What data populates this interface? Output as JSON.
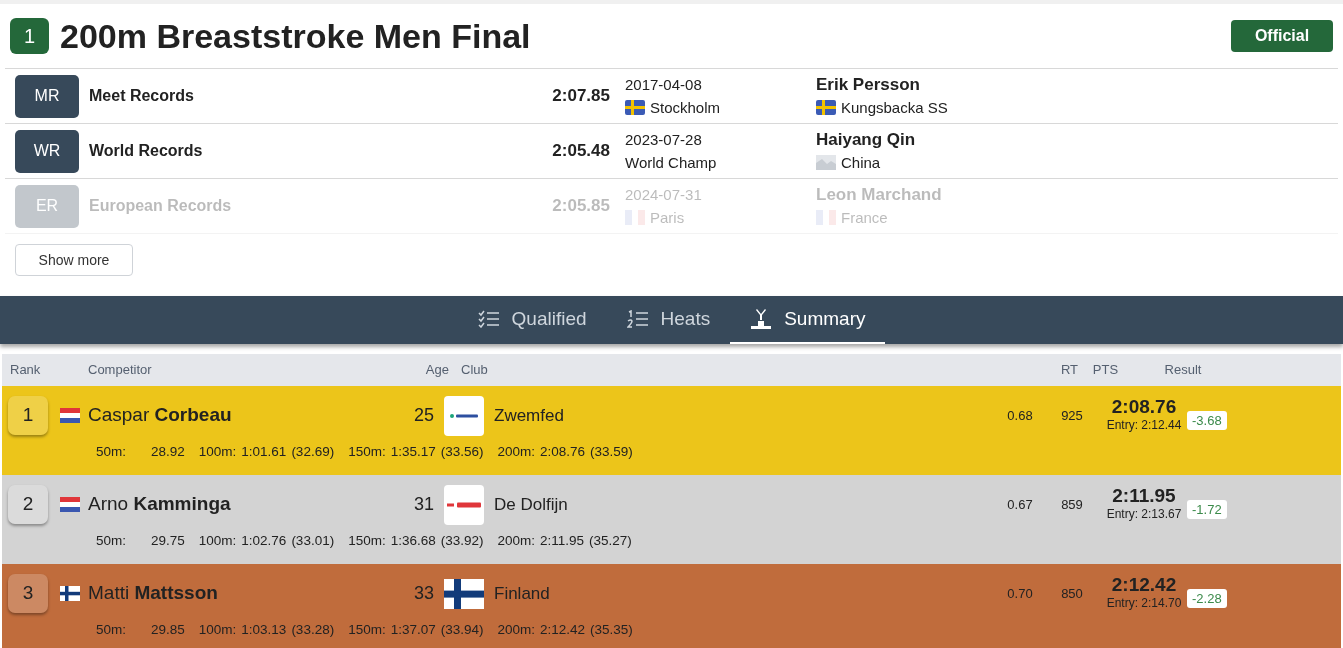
{
  "event": {
    "number": "1",
    "title": "200m Breaststroke Men Final",
    "status": "Official"
  },
  "records": [
    {
      "code": "MR",
      "name": "Meet Records",
      "time": "2:07.85",
      "date": "2017-04-08",
      "place": "Stockholm",
      "place_flag": {
        "kind": "se"
      },
      "holder": "Erik Persson",
      "club": "Kungsbacka SS",
      "club_flag": {
        "kind": "se"
      },
      "faded": false
    },
    {
      "code": "WR",
      "name": "World Records",
      "time": "2:05.48",
      "date": "2023-07-28",
      "place": "World Champ",
      "holder": "Haiyang Qin",
      "club": "China",
      "club_flag": {
        "kind": "placeholder"
      },
      "faded": false
    },
    {
      "code": "ER",
      "name": "European Records",
      "time": "2:05.85",
      "date": "2024-07-31",
      "place": "Paris",
      "place_flag": {
        "kind": "fr"
      },
      "holder": "Leon Marchand",
      "club": "France",
      "club_flag": {
        "kind": "fr"
      },
      "faded": true
    }
  ],
  "show_more": "Show more",
  "tabs": [
    {
      "label": "Qualified",
      "kind": "checklist",
      "selected": false
    },
    {
      "label": "Heats",
      "kind": "numbered",
      "selected": false
    },
    {
      "label": "Summary",
      "kind": "podium",
      "selected": true
    }
  ],
  "table": {
    "columns": [
      "Rank",
      "Competitor",
      "Age",
      "Club",
      "RT",
      "PTS",
      "Result"
    ],
    "rows": [
      {
        "rank": "1",
        "color": "#ecc51a",
        "flag": {
          "kind": "nl"
        },
        "name": "Caspar **Corbeau**",
        "age": "25",
        "club_logo": {
          "kind": "zwemfed"
        },
        "club": "Zwemfed",
        "rt": "0.68",
        "pts": "925",
        "result": "2:08.76",
        "entry": "Entry: 2:12.44",
        "diff": "-3.68",
        "splits": [
          {
            "label": "50m:",
            "time": "28.92"
          },
          {
            "label": "100m:",
            "time": "1:01.61",
            "lap": "(32.69)"
          },
          {
            "label": "150m:",
            "time": "1:35.17",
            "lap": "(33.56)"
          },
          {
            "label": "200m:",
            "time": "2:08.76",
            "lap": "(33.59)"
          }
        ]
      },
      {
        "rank": "2",
        "color": "#d3d3d3",
        "flag": {
          "kind": "nl"
        },
        "name": "Arno **Kamminga**",
        "age": "31",
        "club_logo": {
          "kind": "dolfijn"
        },
        "club": "De Dolfijn",
        "rt": "0.67",
        "pts": "859",
        "result": "2:11.95",
        "entry": "Entry: 2:13.67",
        "diff": "-1.72",
        "splits": [
          {
            "label": "50m:",
            "time": "29.75"
          },
          {
            "label": "100m:",
            "time": "1:02.76",
            "lap": "(33.01)"
          },
          {
            "label": "150m:",
            "time": "1:36.68",
            "lap": "(33.92)"
          },
          {
            "label": "200m:",
            "time": "2:11.95",
            "lap": "(35.27)"
          }
        ]
      },
      {
        "rank": "3",
        "color": "#c06c3c",
        "flag": {
          "kind": "fi"
        },
        "name": "Matti **Mattsson**",
        "age": "33",
        "club_logo": {
          "kind": "fi"
        },
        "club": "Finland",
        "rt": "0.70",
        "pts": "850",
        "result": "2:12.42",
        "entry": "Entry: 2:14.70",
        "diff": "-2.28",
        "splits": [
          {
            "label": "50m:",
            "time": "29.85"
          },
          {
            "label": "100m:",
            "time": "1:03.13",
            "lap": "(33.28)"
          },
          {
            "label": "150m:",
            "time": "1:37.07",
            "lap": "(33.94)"
          },
          {
            "label": "200m:",
            "time": "2:12.42",
            "lap": "(35.35)"
          }
        ]
      }
    ]
  }
}
